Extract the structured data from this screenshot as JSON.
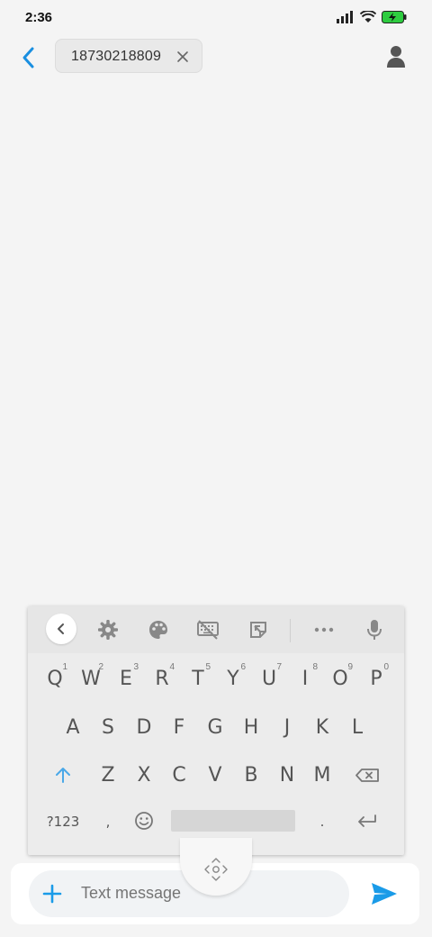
{
  "status_bar": {
    "time": "2:36",
    "icons": [
      "signal-icon",
      "wifi-icon",
      "battery-charging-icon"
    ],
    "battery_color": "#2ecc40"
  },
  "header": {
    "back_icon": "chevron-left-icon",
    "recipient": "18730218809",
    "remove_icon": "close-icon",
    "contact_icon": "person-icon"
  },
  "keyboard": {
    "toolbar": [
      "chevron-left-icon",
      "gear-icon",
      "palette-icon",
      "keyboard-off-icon",
      "note-icon",
      "more-icon",
      "microphone-icon"
    ],
    "row1": [
      {
        "label": "Q",
        "hint": "1"
      },
      {
        "label": "W",
        "hint": "2"
      },
      {
        "label": "E",
        "hint": "3"
      },
      {
        "label": "R",
        "hint": "4"
      },
      {
        "label": "T",
        "hint": "5"
      },
      {
        "label": "Y",
        "hint": "6"
      },
      {
        "label": "U",
        "hint": "7"
      },
      {
        "label": "I",
        "hint": "8"
      },
      {
        "label": "O",
        "hint": "9"
      },
      {
        "label": "P",
        "hint": "0"
      }
    ],
    "row2": [
      "A",
      "S",
      "D",
      "F",
      "G",
      "H",
      "J",
      "K",
      "L"
    ],
    "row3": [
      "Z",
      "X",
      "C",
      "V",
      "B",
      "N",
      "M"
    ],
    "row4": {
      "symbols": "?123",
      "comma": ",",
      "period": "."
    },
    "accent_color": "#4aa8e8"
  },
  "compose": {
    "placeholder": "Text message",
    "add_icon": "plus-icon",
    "send_icon": "send-icon",
    "accent_color": "#1a9be8"
  }
}
